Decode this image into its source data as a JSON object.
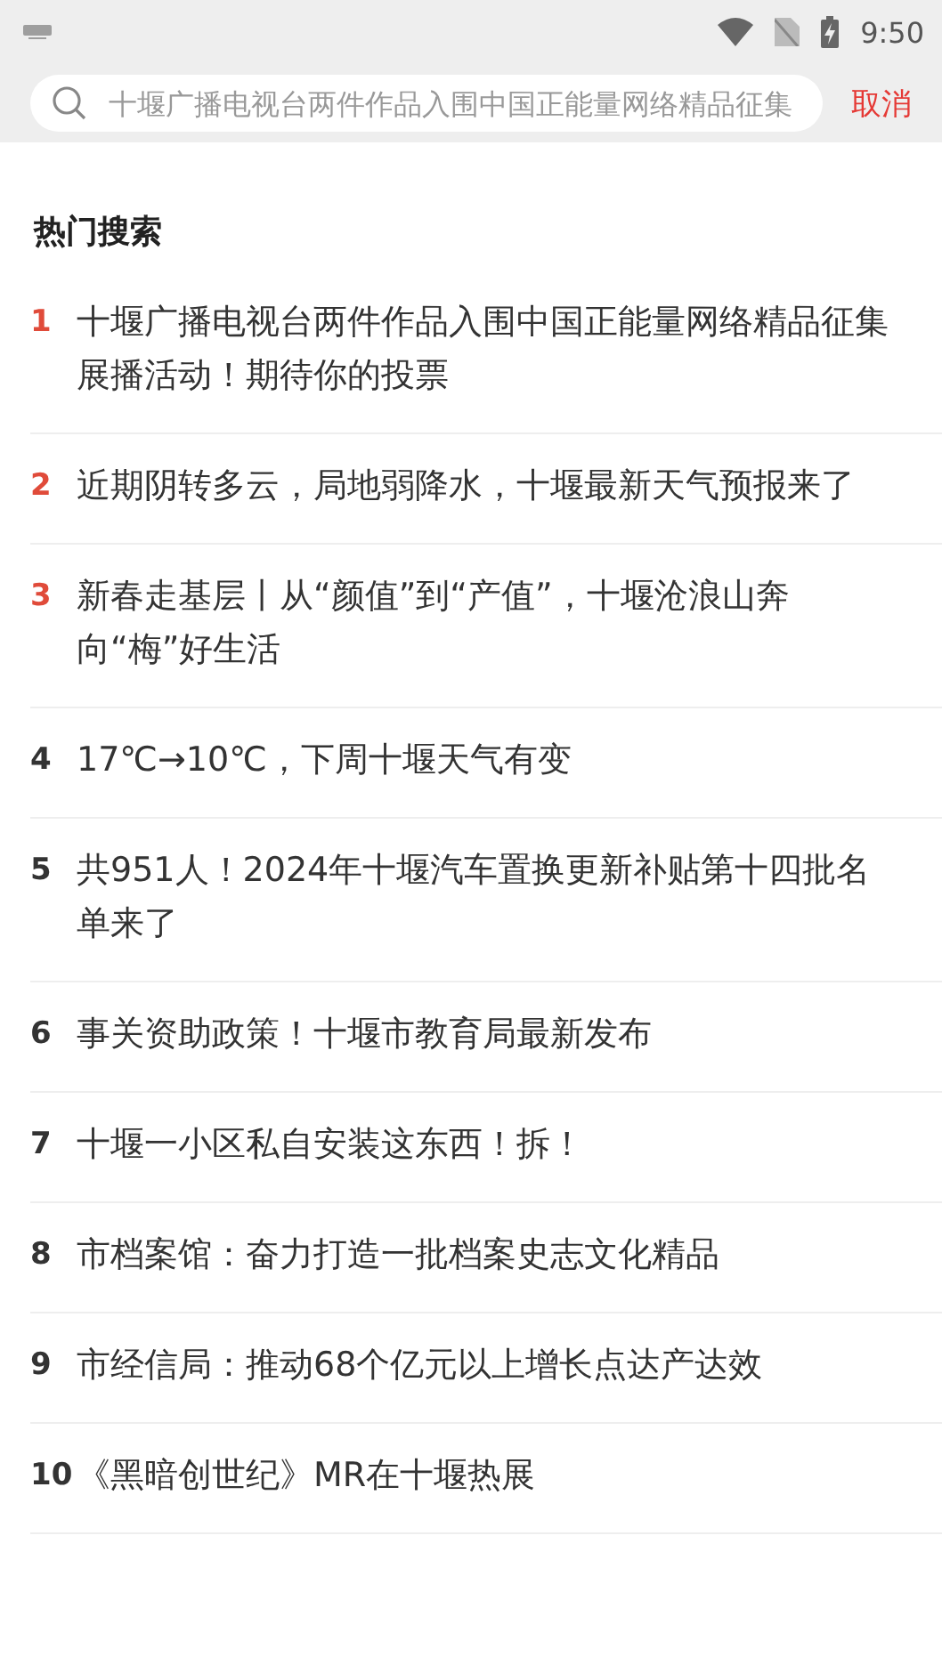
{
  "status_bar": {
    "time": "9:50"
  },
  "search": {
    "placeholder": "十堰广播电视台两件作品入围中国正能量网络精品征集",
    "cancel": "取消"
  },
  "hot_search": {
    "title": "热门搜索",
    "items": [
      {
        "rank": "1",
        "text": "十堰广播电视台两件作品入围中国正能量网络精品征集展播活动！期待你的投票",
        "highlighted": true
      },
      {
        "rank": "2",
        "text": "近期阴转多云，局地弱降水，十堰最新天气预报来了",
        "highlighted": true
      },
      {
        "rank": "3",
        "text": "新春走基层丨从“颜值”到“产值”，十堰沧浪山奔向“梅”好生活",
        "highlighted": true
      },
      {
        "rank": "4",
        "text": "17℃→10℃，下周十堰天气有变",
        "highlighted": false
      },
      {
        "rank": "5",
        "text": "共951人！2024年十堰汽车置换更新补贴第十四批名单来了",
        "highlighted": false
      },
      {
        "rank": "6",
        "text": "事关资助政策！十堰市教育局最新发布",
        "highlighted": false
      },
      {
        "rank": "7",
        "text": "十堰一小区私自安装这东西！拆！",
        "highlighted": false
      },
      {
        "rank": "8",
        "text": "市档案馆：奋力打造一批档案史志文化精品",
        "highlighted": false
      },
      {
        "rank": "9",
        "text": "市经信局：推动68个亿元以上增长点达产达效",
        "highlighted": false
      },
      {
        "rank": "10",
        "text": "《黑暗创世纪》MR在十堰热展",
        "highlighted": false
      }
    ]
  }
}
